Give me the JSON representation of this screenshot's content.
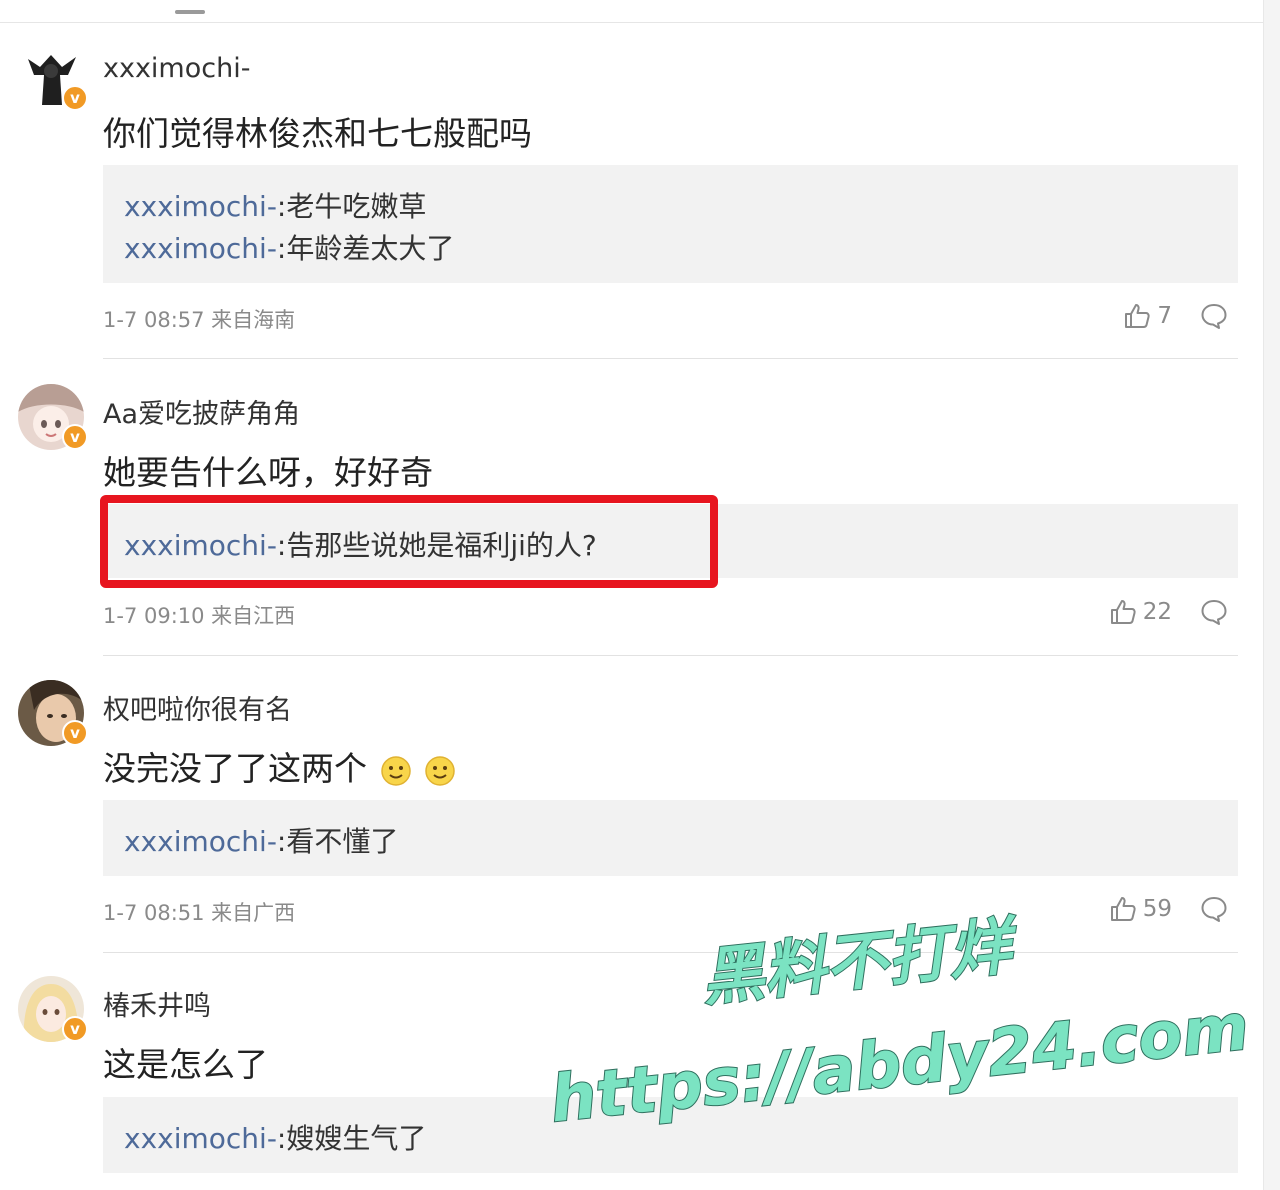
{
  "colors": {
    "username_link": "#4e6a99",
    "verified_badge": "#f19a25",
    "highlight": "#e7151f",
    "watermark": "#7be3c2"
  },
  "comments": [
    {
      "username": "xxximochi-",
      "verified_label": "v",
      "content": "你们觉得林俊杰和七七般配吗",
      "replies": [
        {
          "user": "xxximochi-",
          "text": ":老牛吃嫩草"
        },
        {
          "user": "xxximochi-",
          "text": ":年龄差太大了"
        }
      ],
      "time": "1-7 08:57 来自海南",
      "likes": "7",
      "icons": {
        "like": "thumbs-up-icon",
        "reply": "comment-bubble-icon"
      }
    },
    {
      "username": "Aa爱吃披萨角角",
      "verified_label": "v",
      "content": "她要告什么呀，好好奇",
      "replies": [
        {
          "user": "xxximochi-",
          "text": ":告那些说她是福利ji的人?"
        }
      ],
      "time": "1-7 09:10 来自江西",
      "likes": "22"
    },
    {
      "username": "权吧啦你很有名",
      "verified_label": "v",
      "content": "没完没了了这两个",
      "replies": [
        {
          "user": "xxximochi-",
          "text": ":看不懂了"
        }
      ],
      "time": "1-7 08:51 来自广西",
      "likes": "59"
    },
    {
      "username": "椿禾井鸣",
      "verified_label": "v",
      "content": "这是怎么了",
      "replies": [
        {
          "user": "xxximochi-",
          "text": ":嫂嫂生气了"
        }
      ]
    }
  ],
  "watermark": {
    "line1": "黑料不打烊",
    "line2": "https://abdy24.com"
  }
}
